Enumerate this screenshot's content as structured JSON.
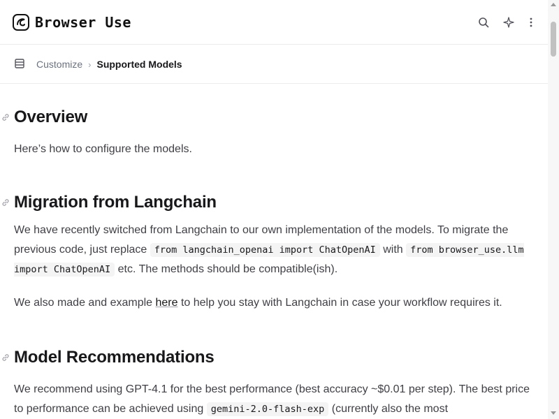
{
  "header": {
    "logo_text": "Browser Use",
    "search_icon": "search-icon",
    "ai_icon": "sparkle-icon",
    "more_icon": "more-vertical-icon"
  },
  "breadcrumb": {
    "menu_icon": "menu-icon",
    "parent": "Customize",
    "separator": "›",
    "current": "Supported Models"
  },
  "sections": {
    "overview": {
      "heading": "Overview",
      "text": "Here’s how to configure the models."
    },
    "migration": {
      "heading": "Migration from Langchain",
      "p1_a": "We have recently switched from Langchain to our own implementation of the models. To migrate the previous code, just replace ",
      "code1": "from langchain_openai import ChatOpenAI",
      "p1_b": " with ",
      "code2": "from browser_use.llm import ChatOpenAI",
      "p1_c": " etc. The methods should be compatible(ish).",
      "p2_a": "We also made and example ",
      "link": "here",
      "p2_b": " to help you stay with Langchain in case your workflow requires it."
    },
    "recommendations": {
      "heading": "Model Recommendations",
      "p_a": "We recommend using GPT-4.1 for the best performance (best accuracy ~$0.01 per step). The best price to performance can be achieved using ",
      "code": "gemini-2.0-flash-exp",
      "p_b": " (currently also the most"
    }
  },
  "colors": {
    "heading": "#18181b",
    "body_text": "#3f3f46",
    "code_bg": "#f4f4f5",
    "divider": "#ececec"
  }
}
